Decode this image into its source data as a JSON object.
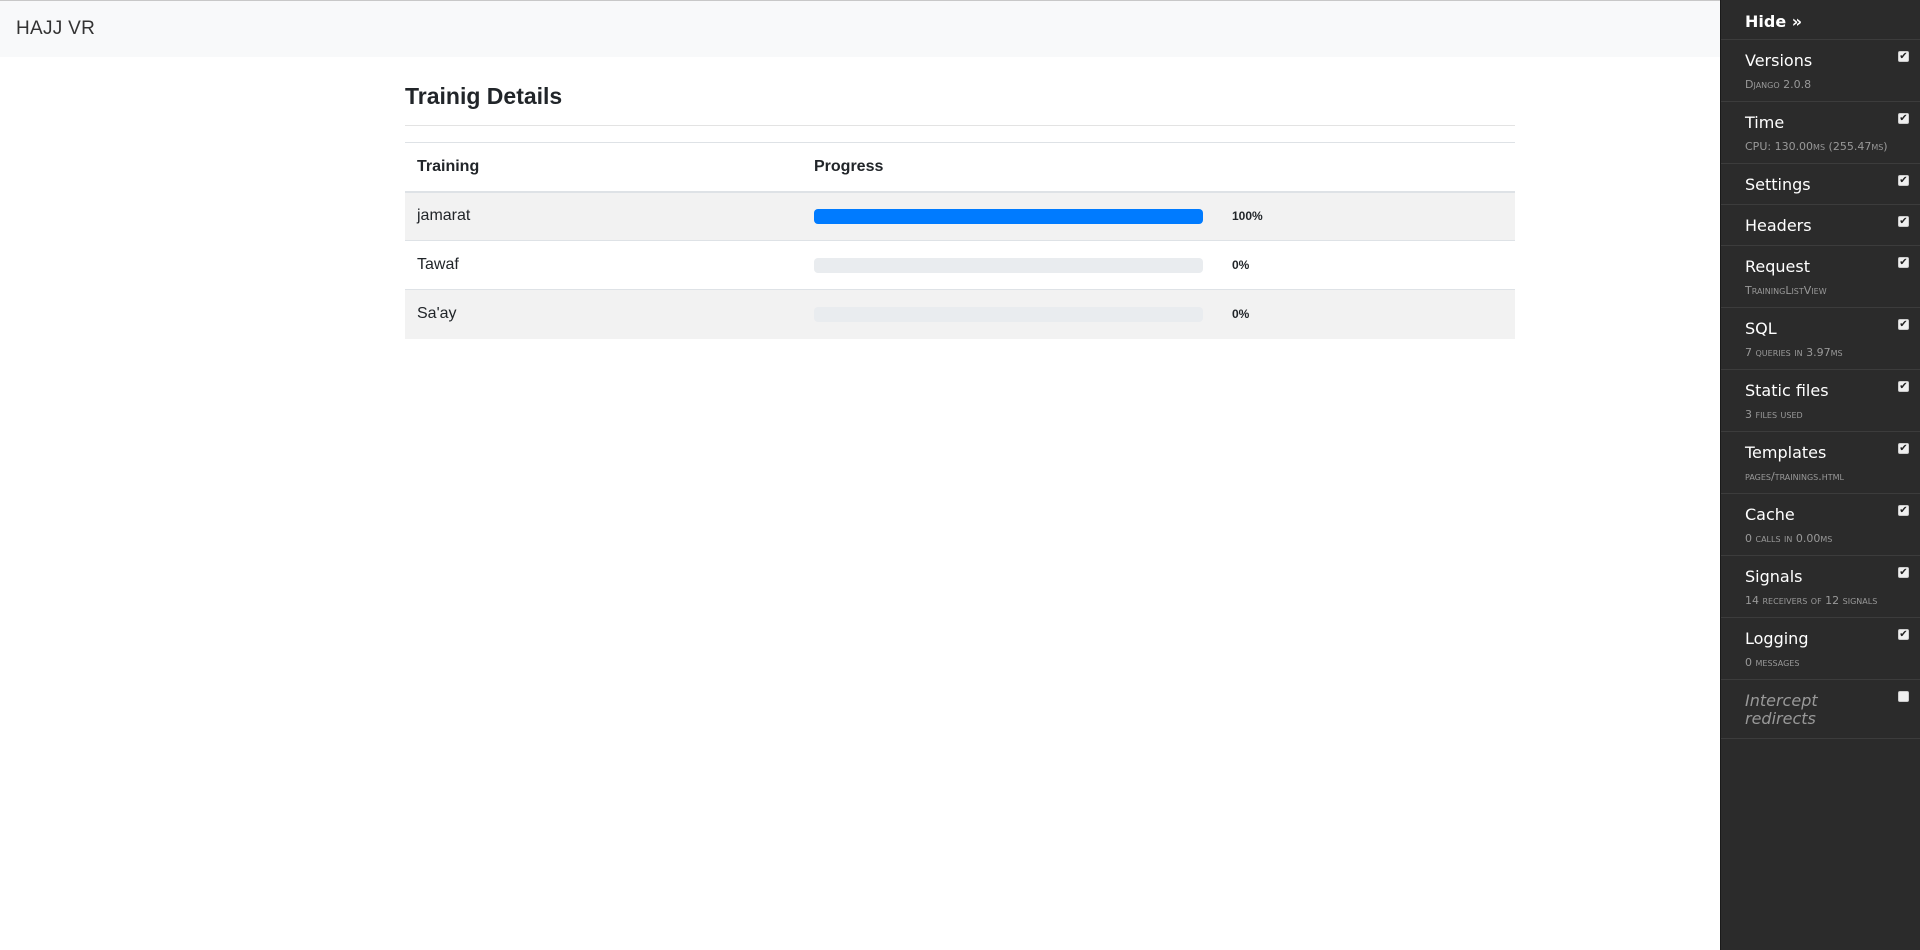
{
  "navbar": {
    "brand": "HAJJ VR"
  },
  "main": {
    "title": "Trainig Details",
    "table": {
      "headers": [
        "Training",
        "Progress"
      ],
      "rows": [
        {
          "training": "jamarat",
          "progress": 100,
          "progress_label": "100%"
        },
        {
          "training": "Tawaf",
          "progress": 0,
          "progress_label": "0%"
        },
        {
          "training": "Sa'ay",
          "progress": 0,
          "progress_label": "0%"
        }
      ]
    }
  },
  "debug_toolbar": {
    "hide_label": "Hide »",
    "panels": [
      {
        "title": "Versions",
        "subtitle": "Django 2.0.8",
        "checked": true
      },
      {
        "title": "Time",
        "subtitle": "CPU: 130.00ms (255.47ms)",
        "checked": true
      },
      {
        "title": "Settings",
        "subtitle": "",
        "checked": true
      },
      {
        "title": "Headers",
        "subtitle": "",
        "checked": true
      },
      {
        "title": "Request",
        "subtitle": "TrainingListView",
        "checked": true
      },
      {
        "title": "SQL",
        "subtitle": "7 queries in 3.97ms",
        "checked": true
      },
      {
        "title": "Static files",
        "subtitle": "3 files used",
        "checked": true
      },
      {
        "title": "Templates",
        "subtitle": "pages/trainings.html",
        "checked": true
      },
      {
        "title": "Cache",
        "subtitle": "0 calls in 0.00ms",
        "checked": true
      },
      {
        "title": "Signals",
        "subtitle": "14 receivers of 12 signals",
        "checked": true
      },
      {
        "title": "Logging",
        "subtitle": "0 messages",
        "checked": true
      }
    ],
    "intercept": {
      "title": "Intercept redirects",
      "checked": false
    }
  },
  "colors": {
    "progress_fill": "#007bff",
    "progress_track": "#e9ecef",
    "toolbar_bg": "#2b2b2b",
    "navbar_bg": "#f8f9fa"
  }
}
